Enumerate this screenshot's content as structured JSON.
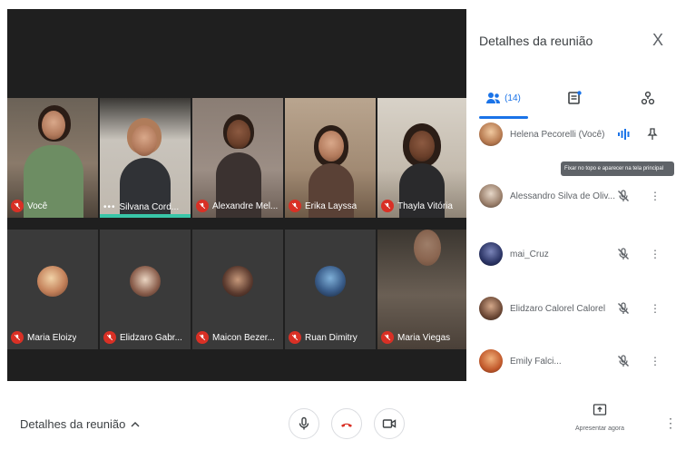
{
  "stage": {
    "row1": [
      {
        "name": "Você",
        "kind": "video",
        "status": "mic-muted"
      },
      {
        "name": "Silvana Cord...",
        "kind": "video",
        "status": "more",
        "selected": true
      },
      {
        "name": "Alexandre Mel...",
        "kind": "video",
        "status": "mic-muted"
      },
      {
        "name": "Erika Layssa",
        "kind": "video",
        "status": "mic-muted"
      },
      {
        "name": "Thayla Vitória",
        "kind": "video",
        "status": "mic-muted"
      }
    ],
    "row2": [
      {
        "name": "Maria Eloizy",
        "kind": "avatar",
        "status": "mic-muted"
      },
      {
        "name": "Elidzaro Gabr...",
        "kind": "avatar",
        "status": "mic-muted"
      },
      {
        "name": "Maicon Bezer...",
        "kind": "avatar",
        "status": "mic-muted"
      },
      {
        "name": "Ruan Dimitry",
        "kind": "avatar",
        "status": "mic-muted"
      },
      {
        "name": "Maria Viegas",
        "kind": "video",
        "status": "mic-muted"
      }
    ]
  },
  "panel": {
    "title": "Detalhes da reunião",
    "close": "X",
    "tabs": {
      "people_count": "(14)"
    },
    "participants": [
      {
        "name": "Helena Pecorelli (Você)",
        "state": "speaking"
      },
      {
        "name": "Alessandro Silva de Oliv...",
        "state": "muted"
      },
      {
        "name": "mai_Cruz",
        "state": "muted"
      },
      {
        "name": "Elidzaro Calorel Calorel",
        "state": "muted"
      },
      {
        "name": "Emily Falci...",
        "state": "muted"
      }
    ],
    "tooltip": "Fixar no topo e aparecer na tela principal"
  },
  "bottombar": {
    "meeting_details": "Detalhes da reunião",
    "present_label": "Apresentar agora",
    "more": "⋮"
  },
  "colors": {
    "accent": "#1a73e8",
    "mute_red": "#d93025",
    "select_bar": "#39c6a8",
    "stage_bg": "#1f1f1f"
  }
}
